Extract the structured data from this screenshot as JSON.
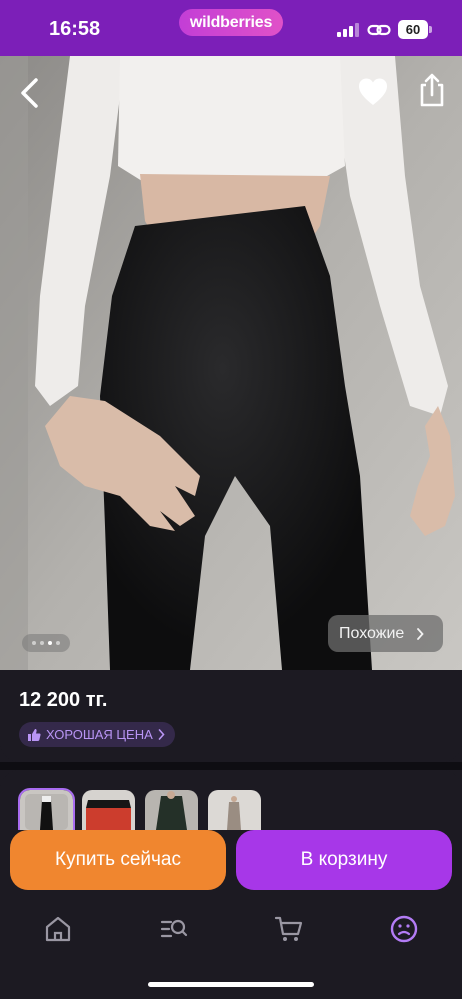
{
  "status": {
    "time": "16:58",
    "brand": "wildberries",
    "battery": "60",
    "signal_icon": "signal-bars-icon",
    "link_icon": "link-icon"
  },
  "product": {
    "price": "12 200 тг.",
    "price_badge": "ХОРОШАЯ ЦЕНА",
    "similar_label": "Похожие",
    "gallery_total_dots": 4,
    "gallery_active_dot": 2
  },
  "actions": {
    "buy_now": "Купить сейчас",
    "add_to_cart": "В корзину"
  },
  "tabs": [
    {
      "name": "home",
      "icon": "home-icon"
    },
    {
      "name": "catalog",
      "icon": "catalog-search-icon"
    },
    {
      "name": "cart",
      "icon": "cart-icon"
    },
    {
      "name": "profile",
      "icon": "profile-icon",
      "active": true
    }
  ],
  "colors": {
    "brand_purple": "#7c1fb8",
    "buy_orange": "#f0862f",
    "cart_purple": "#a737e8",
    "active_tab": "#b37cf5",
    "background": "#1c1a22"
  }
}
